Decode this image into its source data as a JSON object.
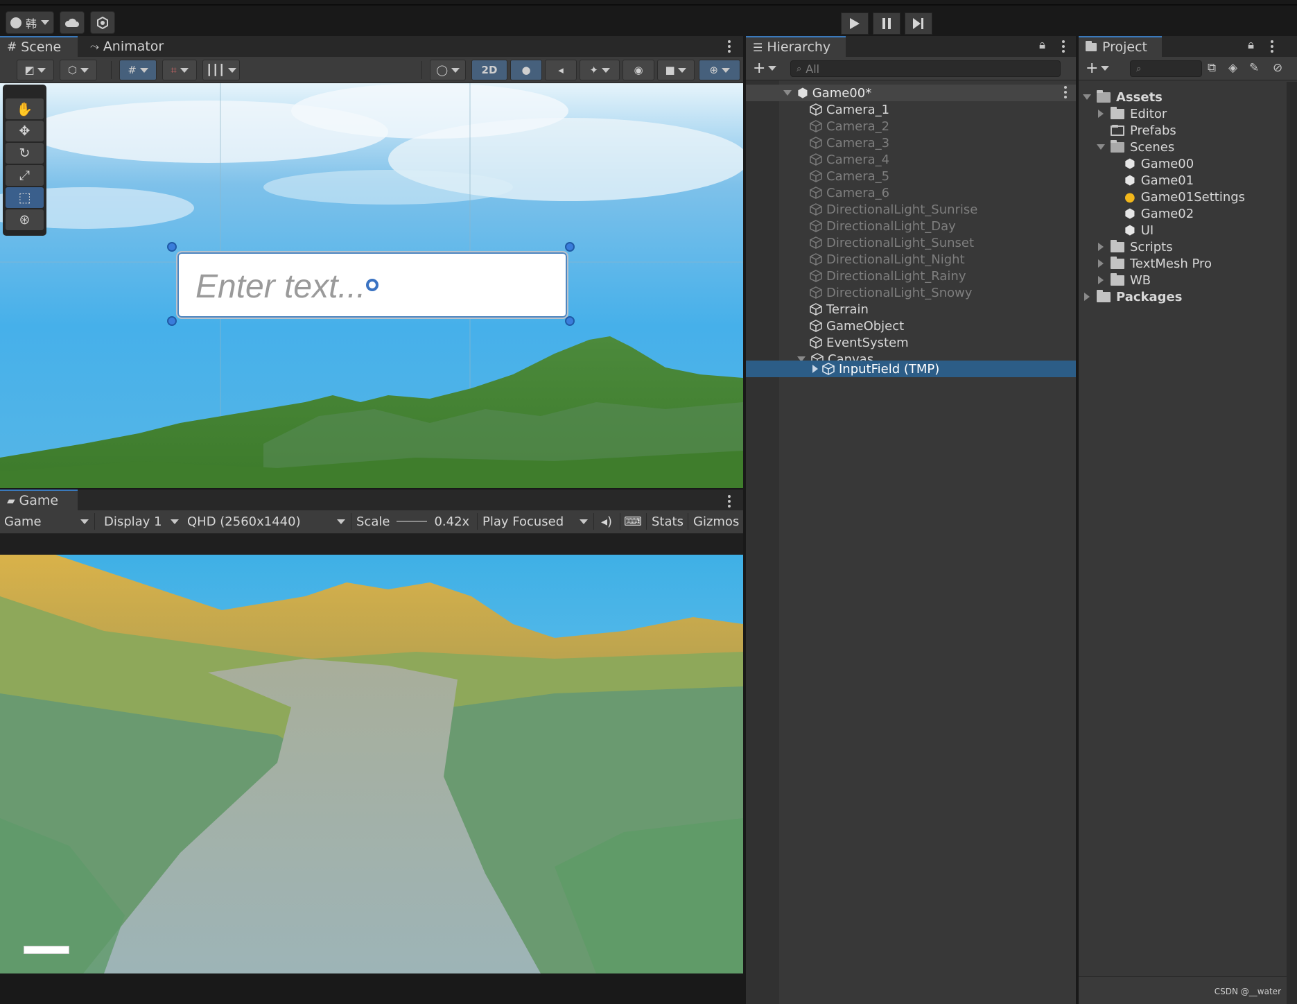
{
  "toolbar": {
    "account_label": "韩",
    "cloud_icon": "cloud-icon",
    "collab_icon": "collab-icon",
    "play_icon": "play-icon",
    "pause_icon": "pause-icon",
    "step_icon": "step-icon"
  },
  "scene": {
    "tabs": [
      "Scene",
      "Animator"
    ],
    "toggle_2d": "2D",
    "input_placeholder": "Enter text..."
  },
  "game": {
    "tab": "Game",
    "view_select": "Game",
    "display_select": "Display 1",
    "resolution_select": "QHD (2560x1440)",
    "scale_label": "Scale",
    "scale_value": "0.42x",
    "play_focused": "Play Focused",
    "stats": "Stats",
    "gizmos": "Gizmos"
  },
  "hierarchy": {
    "title": "Hierarchy",
    "search_placeholder": "All",
    "root": "Game00*",
    "items": [
      {
        "label": "Camera_1",
        "active": true
      },
      {
        "label": "Camera_2",
        "active": false
      },
      {
        "label": "Camera_3",
        "active": false
      },
      {
        "label": "Camera_4",
        "active": false
      },
      {
        "label": "Camera_5",
        "active": false
      },
      {
        "label": "Camera_6",
        "active": false
      },
      {
        "label": "DirectionalLight_Sunrise",
        "active": false
      },
      {
        "label": "DirectionalLight_Day",
        "active": false
      },
      {
        "label": "DirectionalLight_Sunset",
        "active": false
      },
      {
        "label": "DirectionalLight_Night",
        "active": false
      },
      {
        "label": "DirectionalLight_Rainy",
        "active": false
      },
      {
        "label": "DirectionalLight_Snowy",
        "active": false
      },
      {
        "label": "Terrain",
        "active": true
      },
      {
        "label": "GameObject",
        "active": true
      },
      {
        "label": "EventSystem",
        "active": true
      },
      {
        "label": "Canvas",
        "active": true
      }
    ],
    "selected_child": "InputField (TMP)"
  },
  "project": {
    "title": "Project",
    "assets": "Assets",
    "editor": "Editor",
    "prefabs": "Prefabs",
    "scenes": "Scenes",
    "scene_items": [
      "Game00",
      "Game01",
      "Game01Settings",
      "Game02",
      "UI"
    ],
    "scripts": "Scripts",
    "textmesh": "TextMesh Pro",
    "wb": "WB",
    "packages": "Packages"
  },
  "watermark": "CSDN @__water",
  "colors": {
    "accent": "#3a79bb",
    "selection": "#2c5d87",
    "panel": "#383838",
    "header": "#282828"
  }
}
